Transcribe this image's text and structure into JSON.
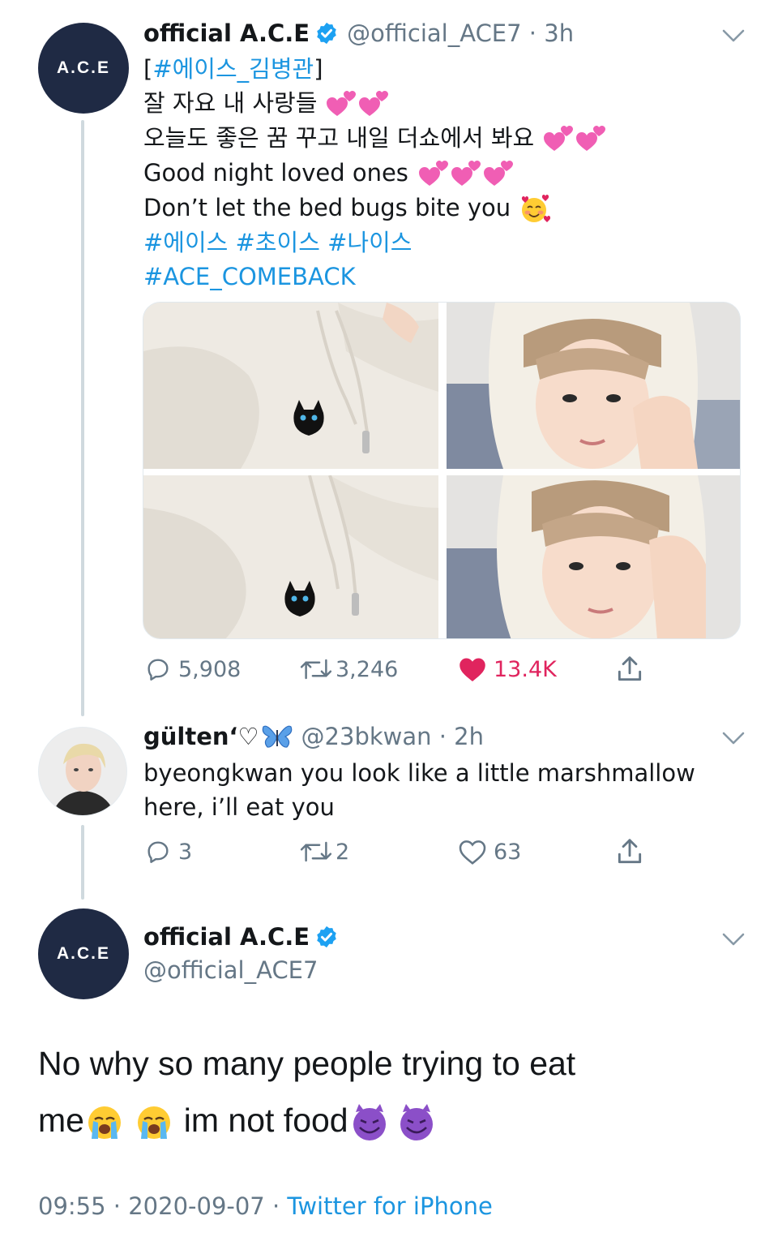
{
  "tweet1": {
    "avatar_text": "A.C.E",
    "name": "official A.C.E",
    "handle": "@official_ACE7 · 3h",
    "lines": [
      {
        "pre": "[",
        "link": "#에이스_김병관",
        "post": "]"
      },
      "잘 자요 내 사랑들",
      "오늘도 좋은 꿈 꾸고 내일 더쇼에서 봐요",
      "Good night loved ones",
      "Don’t let the bed bugs bite you"
    ],
    "hashtags_line1": "#에이스 #초이스 #나이스",
    "hashtags_line2": "#ACE_COMEBACK",
    "replies": "5,908",
    "retweets": "3,246",
    "likes": "13.4K"
  },
  "reply": {
    "name": "gülten‘♡",
    "handle": "@23bkwan · 2h",
    "line1": "byeongkwan you look like a little marshmallow",
    "line2": "here, i’ll eat you",
    "replies": "3",
    "retweets": "2",
    "likes": "63"
  },
  "main_tweet": {
    "avatar_text": "A.C.E",
    "name": "official A.C.E",
    "handle": "@official_ACE7",
    "line1": "No why so many people trying to eat",
    "line2_a": "me",
    "line2_b": " im not food",
    "time": "09:55 · 2020-09-07 · ",
    "source": "Twitter for iPhone"
  },
  "colors": {
    "link": "#1b95e0",
    "secondary": "#657786",
    "like": "#e0245e",
    "avatar_bg": "#1f2a44",
    "verified": "#1da1f2"
  }
}
